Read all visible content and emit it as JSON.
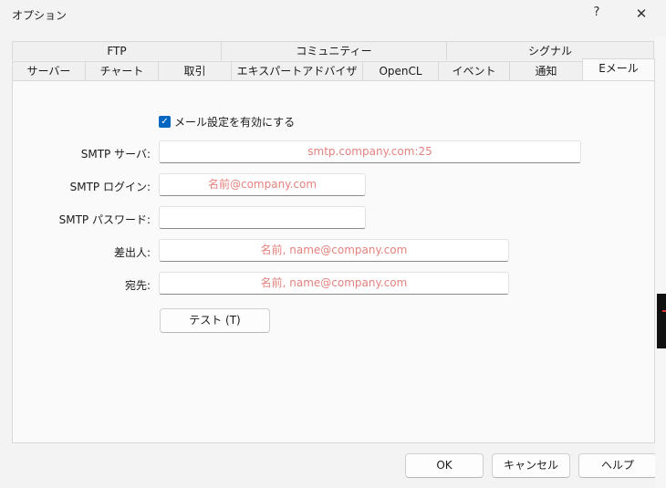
{
  "window": {
    "title": "オプション",
    "help_label": "?",
    "close_label": "✕"
  },
  "tabs_top": [
    "FTP",
    "コミュニティー",
    "シグナル"
  ],
  "tabs_bottom": [
    "サーバー",
    "チャート",
    "取引",
    "エキスパートアドバイザ",
    "OpenCL",
    "イベント",
    "通知",
    "Eメール"
  ],
  "active_tab": "Eメール",
  "email": {
    "enable_label": "メール設定を有効にする",
    "enable_checked": true,
    "smtp_server_label": "SMTP サーバ:",
    "smtp_server_placeholder": "smtp.company.com:25",
    "smtp_login_label": "SMTP ログイン:",
    "smtp_login_placeholder": "名前@company.com",
    "smtp_password_label": "SMTP パスワード:",
    "smtp_password_value": "",
    "from_label": "差出人:",
    "from_placeholder": "名前, name@company.com",
    "to_label": "宛先:",
    "to_placeholder": "名前, name@company.com",
    "test_button": "テスト (T)"
  },
  "footer": {
    "ok": "OK",
    "cancel": "キャンセル",
    "help": "ヘルプ"
  },
  "colors": {
    "accent": "#0067c0",
    "placeholder": "#e4827e"
  }
}
